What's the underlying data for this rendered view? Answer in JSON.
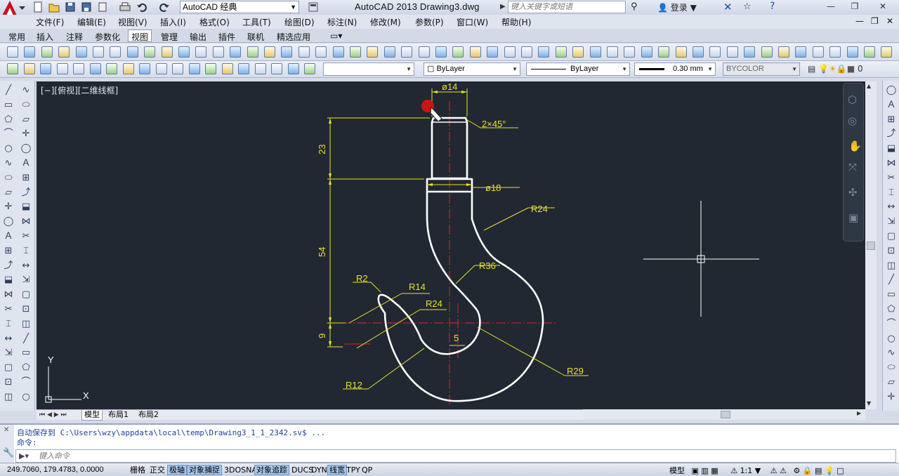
{
  "title": {
    "workspace": "AutoCAD 经典",
    "window_title": "AutoCAD 2013    Drawing3.dwg",
    "search_placeholder": "键入关键字或短语",
    "login": "登录"
  },
  "menus": [
    "文件(F)",
    "编辑(E)",
    "视图(V)",
    "插入(I)",
    "格式(O)",
    "工具(T)",
    "绘图(D)",
    "标注(N)",
    "修改(M)",
    "参数(P)",
    "窗口(W)",
    "帮助(H)"
  ],
  "ribbon_tabs": [
    "常用",
    "插入",
    "注释",
    "参数化",
    "视图",
    "管理",
    "输出",
    "插件",
    "联机",
    "精选应用"
  ],
  "properties": {
    "color": "ByLayer",
    "linetype": "ByLayer",
    "lineweight": "0.30 mm",
    "plotstyle": "BYCOLOR",
    "layer_count": "0"
  },
  "viewport": {
    "label": "[−][俯视][二维线框]",
    "dims": {
      "d14": "ø14",
      "chamfer": "2×45°",
      "d18": "ø18",
      "r24_top": "R24",
      "r36": "R36",
      "r2": "R2",
      "r14": "R14",
      "r24_mid": "R24",
      "r12": "R12",
      "r29": "R29",
      "v23": "23",
      "v54": "54",
      "v9": "9",
      "h5": "5"
    },
    "ucs_x": "X",
    "ucs_y": "Y"
  },
  "layout_tabs": [
    "模型",
    "布局1",
    "布局2"
  ],
  "command": {
    "line1": "自动保存到 C:\\Users\\wzy\\appdata\\local\\temp\\Drawing3_1_1_2342.sv$ ...",
    "line2": "命令:",
    "placeholder": "键入命令"
  },
  "status": {
    "coords": "249.7060, 179.4783, 0.0000",
    "toggles": [
      {
        "label": "栅格",
        "on": false
      },
      {
        "label": "正交",
        "on": false
      },
      {
        "label": "极轴",
        "on": true
      },
      {
        "label": "对象捕捉",
        "on": true
      },
      {
        "label": "3DOSNAP",
        "on": false
      },
      {
        "label": "对象追踪",
        "on": true
      },
      {
        "label": "DUCS",
        "on": false
      },
      {
        "label": "DYN",
        "on": false
      },
      {
        "label": "线宽",
        "on": true
      },
      {
        "label": "TPY",
        "on": false
      },
      {
        "label": "QP",
        "on": false
      }
    ],
    "model": "模型",
    "scale": "1:1"
  },
  "colors": {
    "canvas": "#212832",
    "dimension": "#e6e22a",
    "centerline": "#e0202a",
    "geometry": "#ffffff"
  }
}
